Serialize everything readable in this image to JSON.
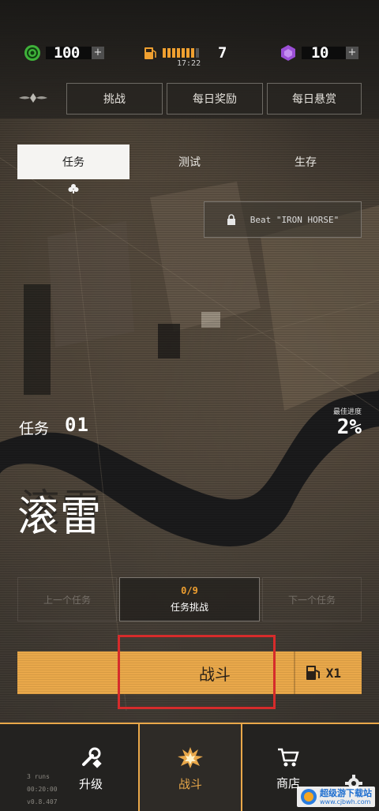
{
  "resources": {
    "coins": "100",
    "fuel": "7",
    "fuel_timer": "17:22",
    "gems": "10",
    "plus": "+"
  },
  "header": {
    "buttons": [
      "挑战",
      "每日奖励",
      "每日悬赏"
    ]
  },
  "tabs": [
    "任务",
    "测试",
    "生存"
  ],
  "unlock_requirement": "Beat \"IRON HORSE\"",
  "mission": {
    "label": "任务",
    "number": "01",
    "name": "滚雷",
    "name_ghost": "滚雷",
    "best_progress_label": "最佳进度",
    "best_progress": "2%"
  },
  "mission_nav": {
    "prev": "上一个任务",
    "challenge_progress": "0/9",
    "challenge_label": "任务挑战",
    "next": "下一个任务"
  },
  "fight": {
    "label": "战斗",
    "fuel_cost": "X1"
  },
  "bottom_nav": [
    {
      "label": "升级",
      "icon": "wrench-icon"
    },
    {
      "label": "战斗",
      "icon": "explosion-icon"
    },
    {
      "label": "商店",
      "icon": "cart-icon"
    }
  ],
  "meta": {
    "runs": "3 runs",
    "time": "00:20:00",
    "version": "v0.8.407"
  },
  "watermark": {
    "line1": "超级游下载站",
    "line2": "www.cjbwh.com"
  },
  "colors": {
    "accent": "#e9a84a",
    "highlight_box": "#d62b2b",
    "coin": "#3fb23a",
    "gem": "#9b4fd6"
  }
}
